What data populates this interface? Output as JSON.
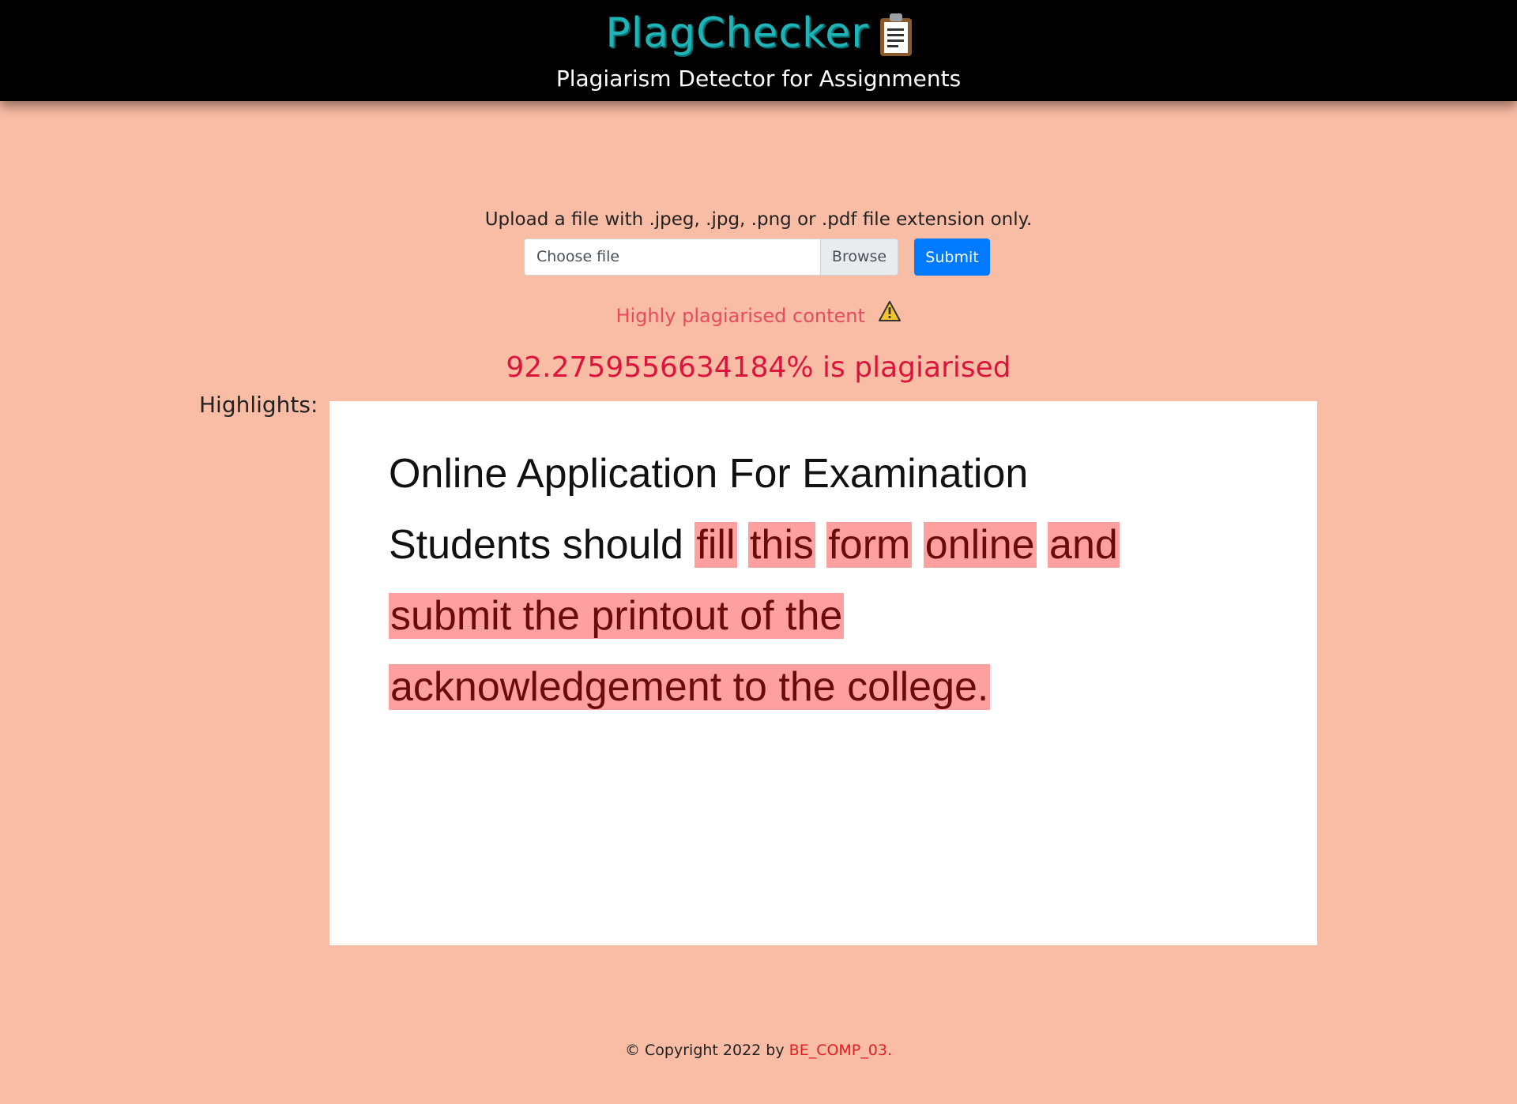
{
  "header": {
    "brand": "PlagChecker",
    "brand_icon": "clipboard-icon",
    "tagline": "Plagiarism Detector for Assignments"
  },
  "upload": {
    "hint": "Upload a file with .jpeg, .jpg, .png or .pdf file extension only.",
    "file_placeholder": "Choose file",
    "browse_label": "Browse",
    "submit_label": "Submit"
  },
  "result": {
    "status": "Highly plagiarised content",
    "status_icon": "warning-icon",
    "percentage_text": "92.2759556634184% is plagiarised",
    "percentage_value": 92.2759556634184
  },
  "highlights": {
    "label": "Highlights:",
    "lines": [
      [
        {
          "text": "Online Application For Examination",
          "plagiarised": false
        }
      ],
      [
        {
          "text": "Students should",
          "plagiarised": false
        },
        {
          "text": "fill",
          "plagiarised": true
        },
        {
          "text": "this",
          "plagiarised": true
        },
        {
          "text": "form",
          "plagiarised": true
        },
        {
          "text": "online",
          "plagiarised": true
        },
        {
          "text": "and",
          "plagiarised": true
        }
      ],
      [
        {
          "text": "submit the printout of the",
          "plagiarised": true
        }
      ],
      [
        {
          "text": "acknowledgement to the college.",
          "plagiarised": true
        }
      ]
    ]
  },
  "footer": {
    "copyright_symbol": "©",
    "copyright_text": "Copyright 2022 by",
    "author": "BE_COMP_03",
    "trailing": "."
  },
  "colors": {
    "page_background": "#f9bca5",
    "header_background": "#000000",
    "brand": "#1fb5b8",
    "status_warning": "#e84b5b",
    "percentage": "#dc143c",
    "submit_button": "#007bff",
    "highlight_mark": "#ffa0a0",
    "footer_author": "#e31e24"
  }
}
